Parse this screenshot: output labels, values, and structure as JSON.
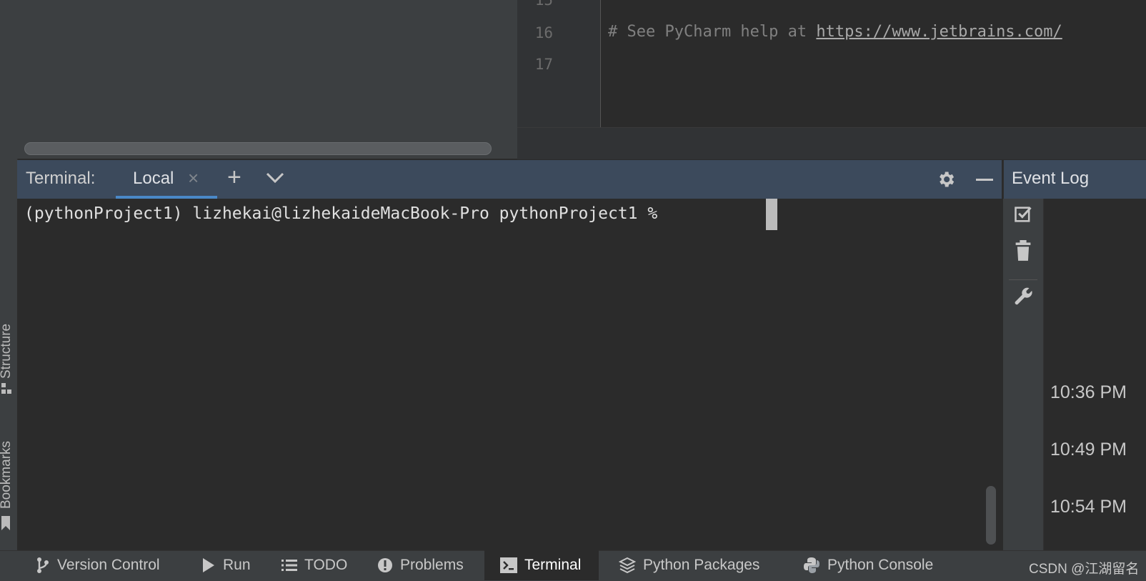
{
  "left_strip": {
    "structure_label": "Structure",
    "bookmarks_label": "Bookmarks"
  },
  "editor": {
    "line_numbers": [
      "15",
      "16",
      "17"
    ],
    "code_comment_prefix": "# See PyCharm help at ",
    "code_link": "https://www.jetbrains.com/"
  },
  "terminal": {
    "title": "Terminal:",
    "tab_label": "Local",
    "prompt": "(pythonProject1) lizhekai@lizhekaideMacBook-Pro pythonProject1 % "
  },
  "event_log": {
    "title": "Event Log",
    "times": [
      "10:36 PM",
      "10:49 PM",
      "10:54 PM"
    ]
  },
  "bottom_bar": {
    "items": [
      "Version Control",
      "Run",
      "TODO",
      "Problems",
      "Terminal",
      "Python Packages",
      "Python Console"
    ],
    "active": "Terminal"
  },
  "watermark": "CSDN @江湖留名",
  "icons": {
    "vcs": "branch-icon",
    "run": "play-icon",
    "todo": "list-icon",
    "problems": "exclamation-icon",
    "terminal": "terminal-icon",
    "packages": "layers-icon",
    "console": "python-icon",
    "event_toolbar": [
      "check-icon",
      "trash-icon",
      "wrench-icon"
    ]
  },
  "colors": {
    "accent": "#4a88c7",
    "header_bg": "#3c4a5c",
    "panel_bg": "#3c3f41",
    "editor_bg": "#2b2b2b"
  }
}
